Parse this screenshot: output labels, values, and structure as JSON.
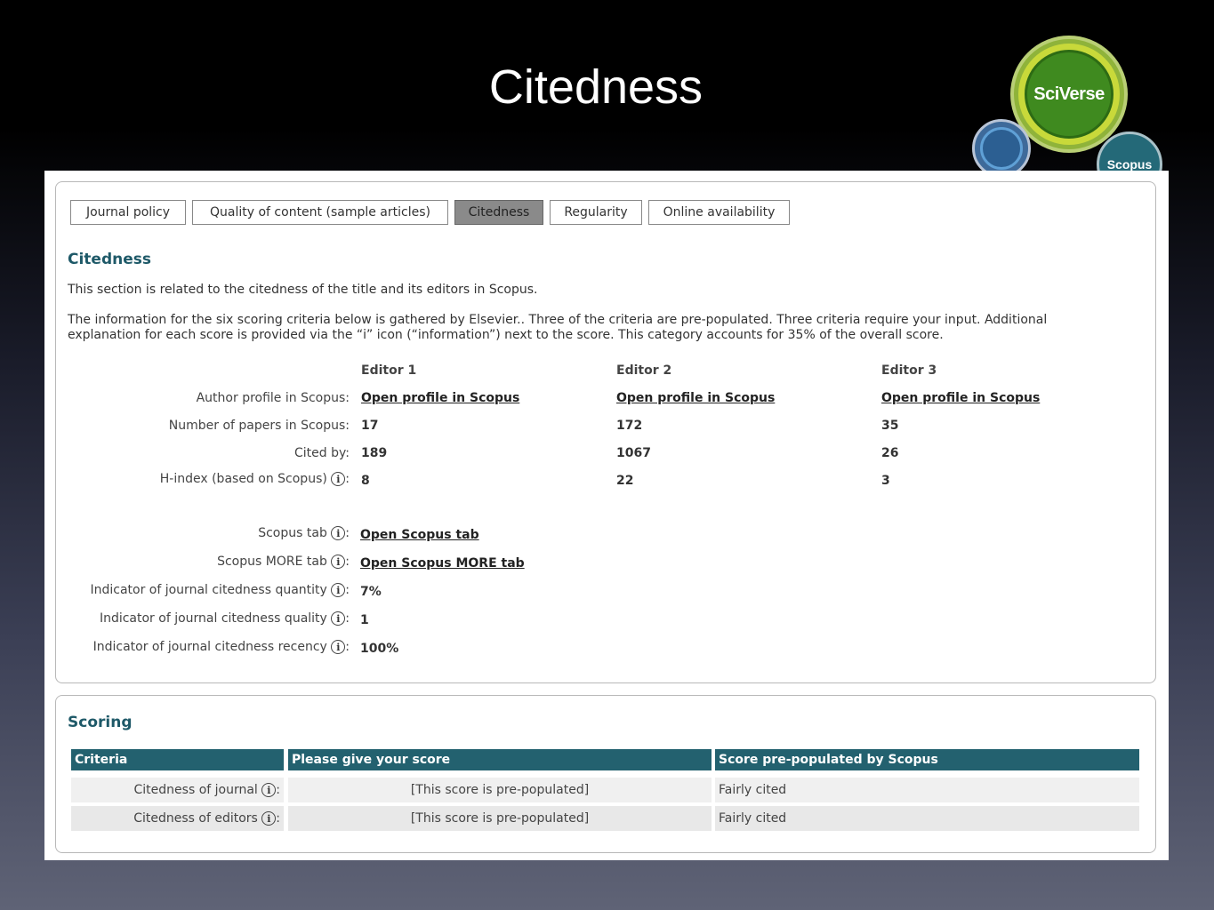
{
  "slide_title": "Citedness",
  "logo": {
    "big_text": "SciVerse",
    "small_text": "Scopus"
  },
  "tabs": [
    {
      "label": "Journal policy",
      "active": false
    },
    {
      "label": "Quality of content (sample articles)",
      "active": false
    },
    {
      "label": "Citedness",
      "active": true
    },
    {
      "label": "Regularity",
      "active": false
    },
    {
      "label": "Online availability",
      "active": false
    }
  ],
  "citedness": {
    "heading": "Citedness",
    "intro": "This section is related to the citedness of the title and its editors in Scopus.",
    "info_line1": "The information for the six scoring criteria below is gathered by Elsevier.. Three of the criteria are pre-populated. Three criteria require your input. Additional",
    "info_line2": "explanation for each score is provided via the “i” icon (“information”) next to the score. This category accounts for 35% of the overall score.",
    "editors": [
      "Editor 1",
      "Editor 2",
      "Editor 3"
    ],
    "rows": {
      "profile_label": "Author profile in Scopus:",
      "profile_links": [
        "Open profile in Scopus",
        "Open profile in Scopus",
        "Open profile in Scopus"
      ],
      "papers_label": "Number of papers in Scopus:",
      "papers": [
        "17",
        "172",
        "35"
      ],
      "cited_label": "Cited by:",
      "cited": [
        "189",
        "1067",
        "26"
      ],
      "hindex_label": "H-index (based on Scopus)",
      "hindex": [
        "8",
        "22",
        "3"
      ]
    },
    "extra": {
      "scopus_tab_label": "Scopus tab",
      "scopus_tab_link": "Open Scopus tab",
      "scopus_more_label": "Scopus MORE tab",
      "scopus_more_link": "Open Scopus MORE tab",
      "quantity_label": "Indicator of journal citedness quantity",
      "quantity_value": "7%",
      "quality_label": "Indicator of journal citedness quality",
      "quality_value": "1",
      "recency_label": "Indicator of journal citedness recency",
      "recency_value": "100%"
    }
  },
  "scoring": {
    "heading": "Scoring",
    "columns": [
      "Criteria",
      "Please give your score",
      "Score pre-populated by Scopus"
    ],
    "rows": [
      {
        "criteria": "Citedness of journal",
        "score": "[This score is pre-populated]",
        "prepop": "Fairly cited"
      },
      {
        "criteria": "Citedness of editors",
        "score": "[This score is pre-populated]",
        "prepop": "Fairly cited"
      }
    ]
  }
}
